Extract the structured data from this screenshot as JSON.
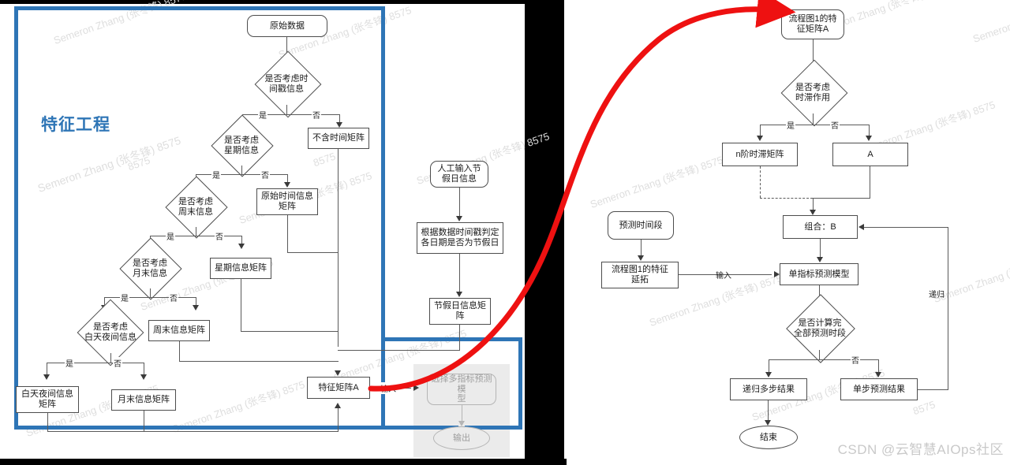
{
  "meta": {
    "watermark_repeat": "Semeron Zhang (张冬锋) 8575",
    "watermark_short": "8575",
    "credit": "CSDN @云智慧AIOps社区"
  },
  "left_panel": {
    "title": "特征工程",
    "accent_color": "#2E75B6",
    "start_node": "原始数据",
    "decisions": [
      {
        "id": "d_timestamp",
        "label": "是否考虑时\n间戳信息"
      },
      {
        "id": "d_weekday",
        "label": "是否考虑\n星期信息"
      },
      {
        "id": "d_weekend",
        "label": "是否考虑\n周末信息"
      },
      {
        "id": "d_monthend",
        "label": "是否考虑\n月末信息"
      },
      {
        "id": "d_daynight",
        "label": "是否考虑\n白天夜间信息"
      }
    ],
    "yes_label": "是",
    "no_label": "否",
    "result_boxes": [
      {
        "id": "b_notime",
        "label": "不含时间矩阵"
      },
      {
        "id": "b_rawtime",
        "label": "原始时间信息\n矩阵"
      },
      {
        "id": "b_weekday",
        "label": "星期信息矩阵"
      },
      {
        "id": "b_weekend",
        "label": "周末信息矩阵"
      },
      {
        "id": "b_daynight",
        "label": "白天夜间信息\n矩阵"
      },
      {
        "id": "b_monthend",
        "label": "月末信息矩阵"
      }
    ],
    "holiday_branch": {
      "input": "人工输入节\n假日信息",
      "process": "根据数据时间戳判定\n各日期是否为节假日",
      "output": "节假日信息矩\n阵"
    },
    "feature_matrix": "特征矩阵A",
    "input_edge_label": "输入",
    "dimmed": {
      "model": "选择多指标预测模\n型",
      "output": "输出"
    }
  },
  "right_panel": {
    "start_node": "流程图1的特\n征矩阵A",
    "decisions": [
      {
        "id": "d_lag",
        "label": "是否考虑\n时滞作用"
      },
      {
        "id": "d_done",
        "label": "是否计算完\n全部预测时段"
      }
    ],
    "yes_label": "是",
    "no_label": "否",
    "boxes": [
      {
        "id": "b_lagmatrix",
        "label": "n阶时滞矩阵"
      },
      {
        "id": "b_a",
        "label": "A"
      },
      {
        "id": "b_combine",
        "label": "组合：B"
      },
      {
        "id": "b_model",
        "label": "单指标预测模型"
      },
      {
        "id": "b_recursive",
        "label": "递归多步结果"
      },
      {
        "id": "b_onestep",
        "label": "单步预测结果"
      },
      {
        "id": "b_extend",
        "label": "流程图1的特征\n延拓"
      }
    ],
    "period_node": "预测时间段",
    "input_edge_label": "输入",
    "recursion_edge_label": "递归",
    "end_node": "结束"
  }
}
